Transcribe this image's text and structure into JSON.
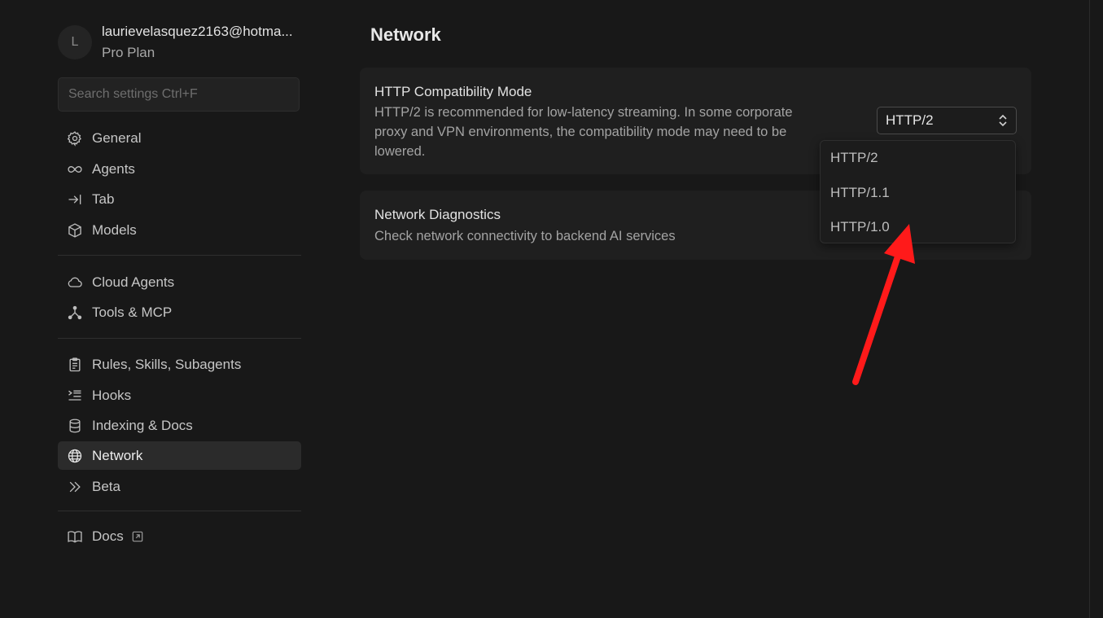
{
  "account": {
    "avatar_letter": "L",
    "email": "laurievelasquez2163@hotma...",
    "plan": "Pro Plan"
  },
  "search": {
    "placeholder": "Search settings Ctrl+F"
  },
  "sidebar": {
    "items": [
      {
        "label": "General",
        "icon": "gear-icon"
      },
      {
        "label": "Agents",
        "icon": "infinity-icon"
      },
      {
        "label": "Tab",
        "icon": "tab-arrow-icon"
      },
      {
        "label": "Models",
        "icon": "cube-icon"
      },
      {
        "label": "Cloud Agents",
        "icon": "cloud-icon"
      },
      {
        "label": "Tools & MCP",
        "icon": "nodes-icon"
      },
      {
        "label": "Rules, Skills, Subagents",
        "icon": "clipboard-icon"
      },
      {
        "label": "Hooks",
        "icon": "hooks-list-icon"
      },
      {
        "label": "Indexing & Docs",
        "icon": "database-icon"
      },
      {
        "label": "Network",
        "icon": "globe-icon",
        "active": true
      },
      {
        "label": "Beta",
        "icon": "double-chevron-icon"
      },
      {
        "label": "Docs",
        "icon": "book-icon"
      }
    ]
  },
  "main": {
    "title": "Network",
    "http_mode": {
      "title": "HTTP Compatibility Mode",
      "desc_line1": "HTTP/2 is recommended for low-latency streaming. In some corporate",
      "desc_line2": "proxy and VPN environments, the compatibility mode may need to be",
      "desc_line3": "lowered.",
      "selected": "HTTP/2",
      "options": [
        "HTTP/2",
        "HTTP/1.1",
        "HTTP/1.0"
      ]
    },
    "diagnostics": {
      "title": "Network Diagnostics",
      "desc": "Check network connectivity to backend AI services"
    }
  },
  "colors": {
    "background": "#181818",
    "card": "#1f1f1f",
    "active_item": "#2b2b2b",
    "annotation_arrow": "#ff1a1a"
  }
}
